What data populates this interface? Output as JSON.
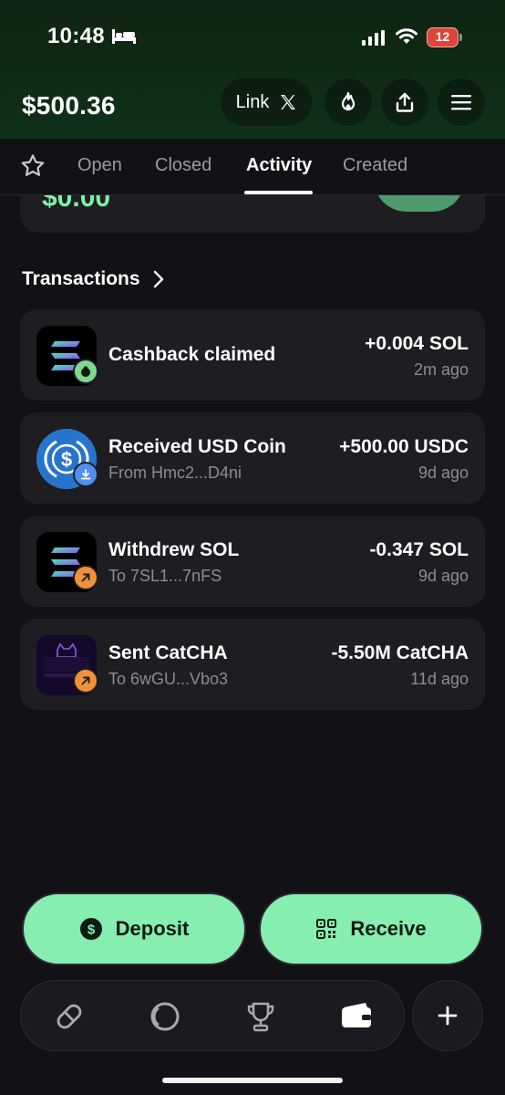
{
  "status_bar": {
    "time": "10:48",
    "battery": "12"
  },
  "header": {
    "balance": "$500.36",
    "link_label": "Link",
    "icons": [
      "x-logo-icon",
      "fire-icon",
      "share-icon",
      "menu-icon"
    ]
  },
  "tabs": [
    {
      "label": "Open",
      "active": false
    },
    {
      "label": "Closed",
      "active": false
    },
    {
      "label": "Activity",
      "active": true
    },
    {
      "label": "Created",
      "active": false
    }
  ],
  "partial_card": {
    "amount": "$0.00"
  },
  "transactions": {
    "title": "Transactions",
    "items": [
      {
        "title": "Cashback claimed",
        "subtitle": "",
        "amount": "+0.004 SOL",
        "time": "2m ago",
        "icon": "solana-logo",
        "badge": "cashback-icon",
        "badge_color": "#7ed88f"
      },
      {
        "title": "Received USD Coin",
        "subtitle": "From Hmc2...D4ni",
        "amount": "+500.00 USDC",
        "time": "9d ago",
        "icon": "usdc-logo",
        "badge": "download-icon",
        "badge_color": "#4f8ff0"
      },
      {
        "title": "Withdrew SOL",
        "subtitle": "To 7SL1...7nFS",
        "amount": "-0.347 SOL",
        "time": "9d ago",
        "icon": "solana-logo",
        "badge": "arrow-up-right-icon",
        "badge_color": "#f0923a"
      },
      {
        "title": "Sent CatCHA",
        "subtitle": "To 6wGU...Vbo3",
        "amount": "-5.50M CatCHA",
        "time": "11d ago",
        "icon": "catcha-logo",
        "badge": "arrow-up-right-icon",
        "badge_color": "#f0923a"
      }
    ]
  },
  "actions": {
    "deposit_label": "Deposit",
    "receive_label": "Receive"
  },
  "nav": {
    "items": [
      "pill-icon",
      "ring-icon",
      "trophy-icon",
      "wallet-icon"
    ],
    "plus": "plus-icon"
  },
  "colors": {
    "accent": "#86eeb0",
    "background": "#121216",
    "card": "#1d1d22",
    "positive": "#7ef0a8"
  }
}
